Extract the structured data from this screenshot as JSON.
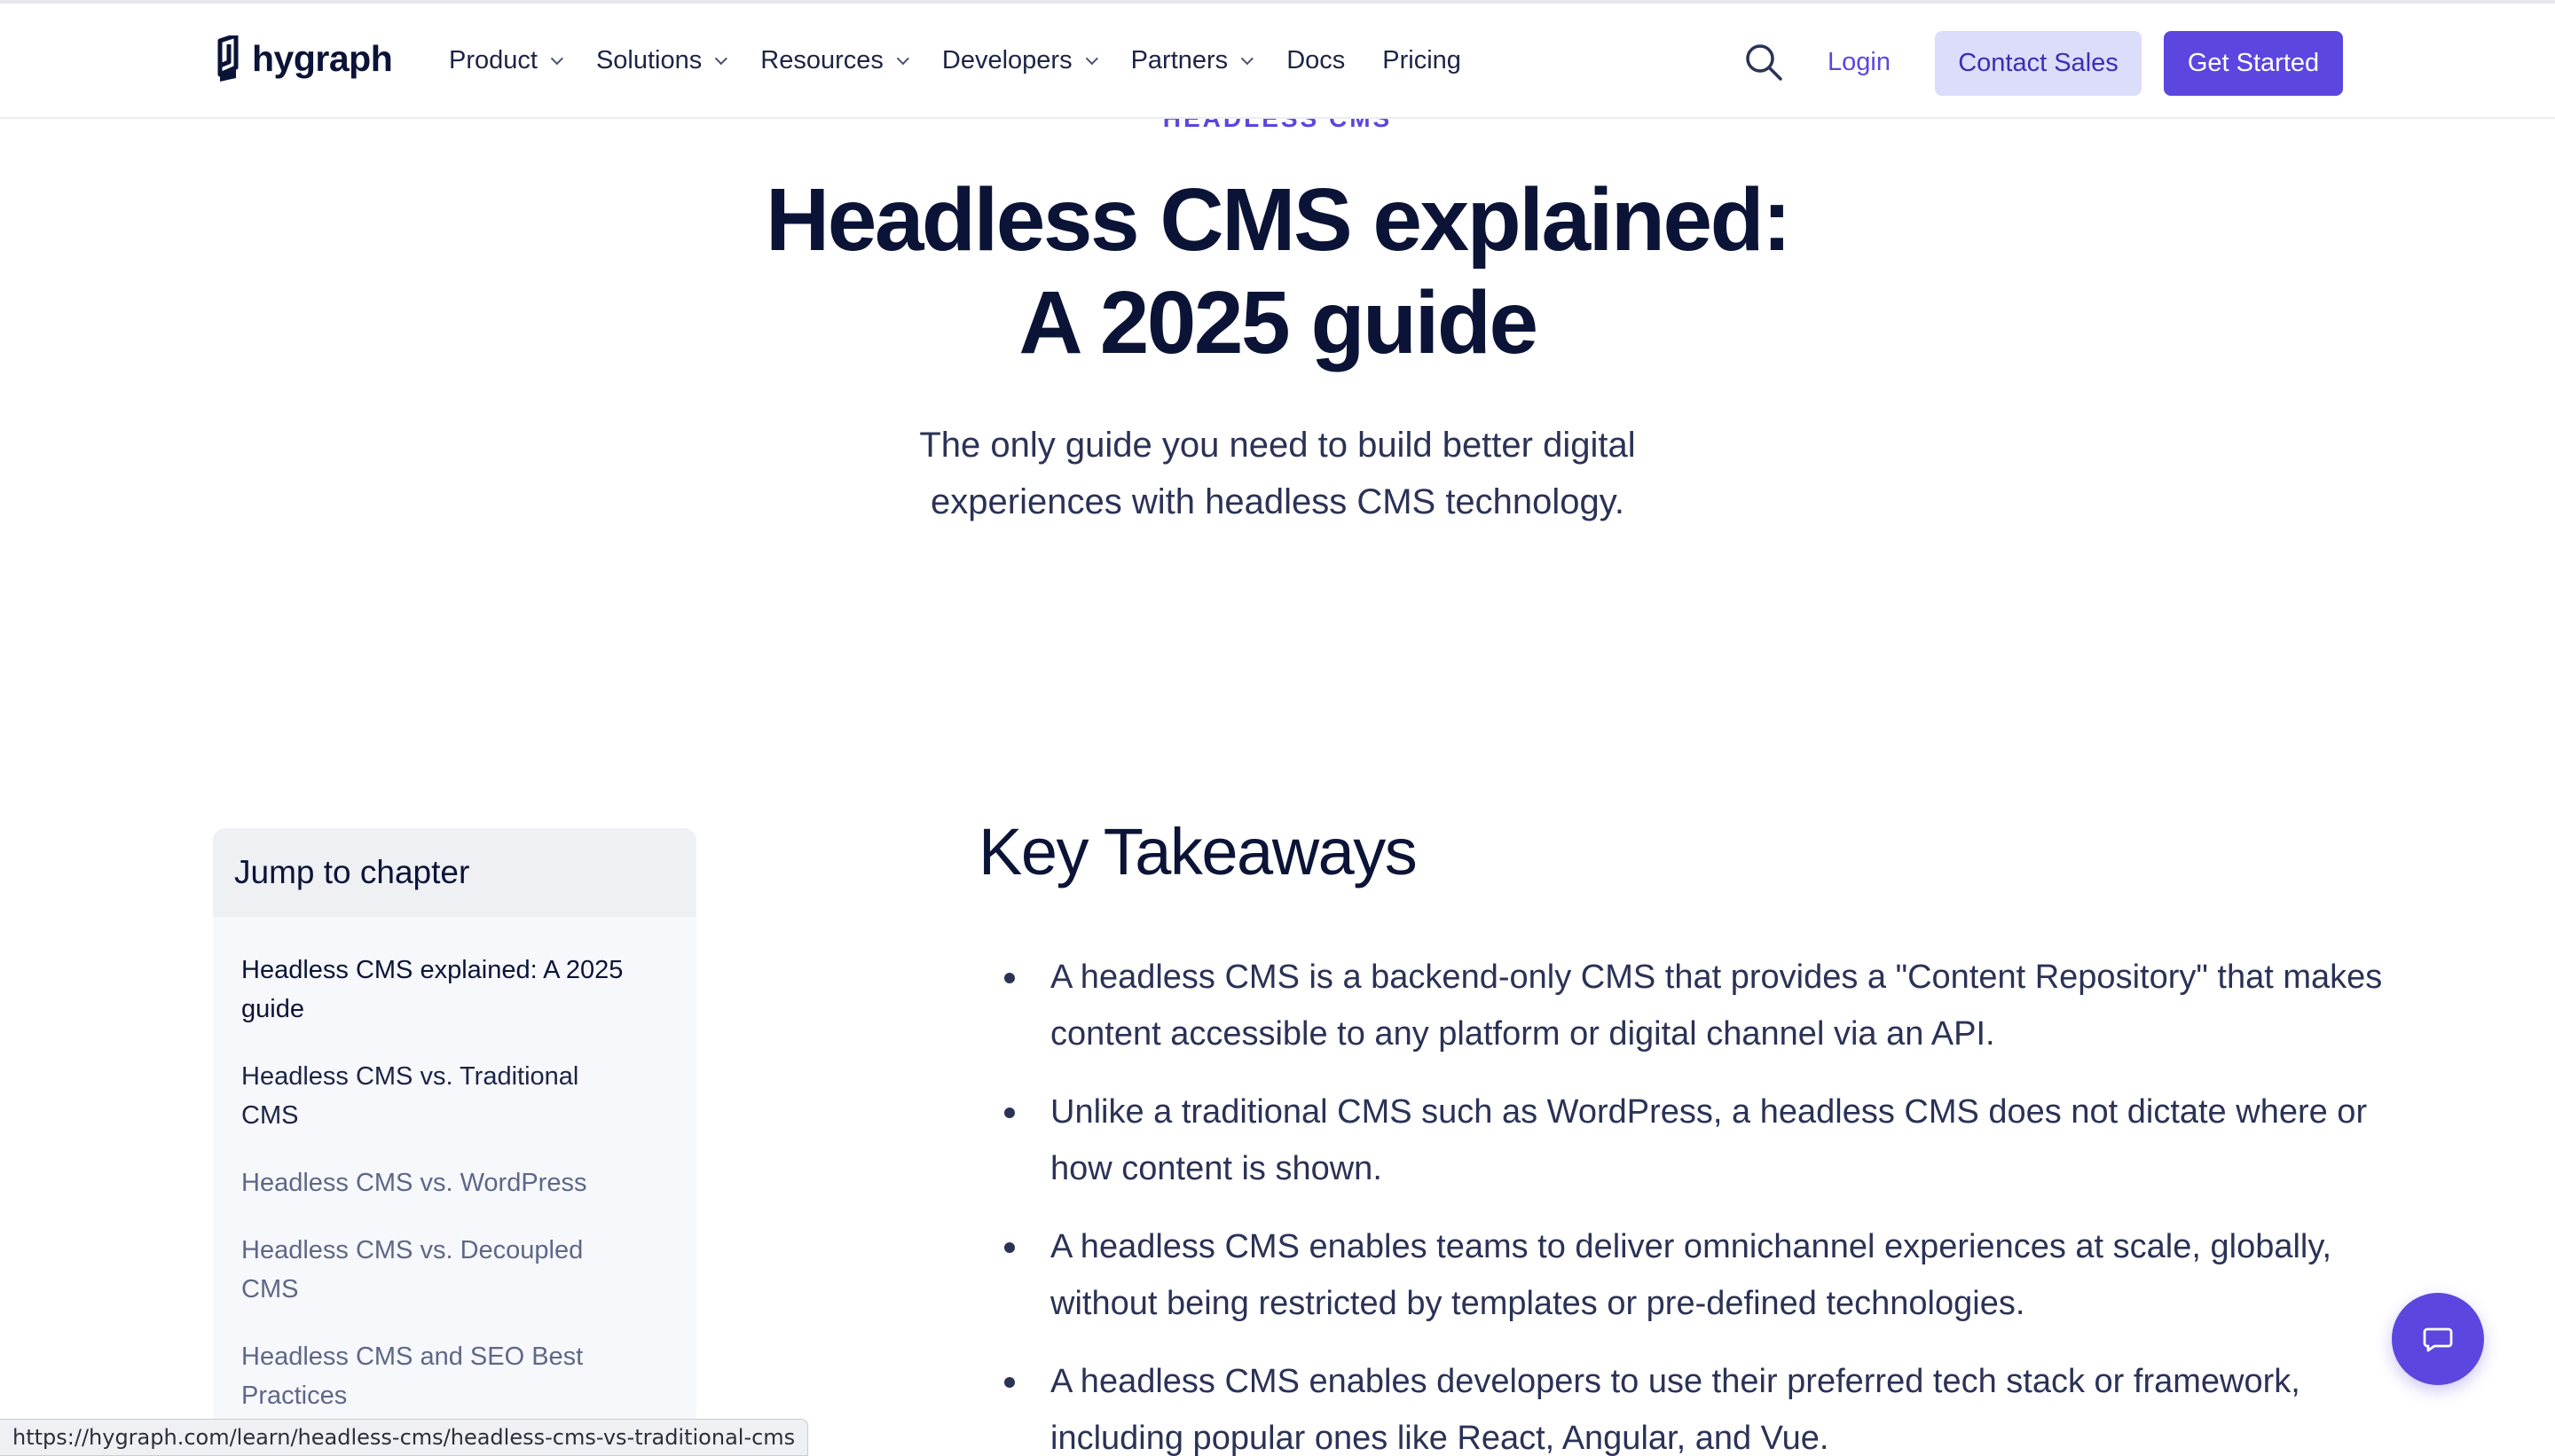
{
  "header": {
    "logo_text": "hygraph",
    "nav": [
      {
        "label": "Product",
        "has_dropdown": true
      },
      {
        "label": "Solutions",
        "has_dropdown": true
      },
      {
        "label": "Resources",
        "has_dropdown": true
      },
      {
        "label": "Developers",
        "has_dropdown": true
      },
      {
        "label": "Partners",
        "has_dropdown": true
      },
      {
        "label": "Docs",
        "has_dropdown": false
      },
      {
        "label": "Pricing",
        "has_dropdown": false
      }
    ],
    "search_icon": "search-icon",
    "login_label": "Login",
    "contact_sales_label": "Contact Sales",
    "get_started_label": "Get Started"
  },
  "hero": {
    "eyebrow": "HEADLESS CMS",
    "title": "Headless CMS explained: A 2025 guide",
    "subtitle": "The only guide you need to build better digital experiences with headless CMS technology."
  },
  "toc": {
    "heading": "Jump to chapter",
    "items": [
      "Headless CMS explained: A 2025 guide",
      "Headless CMS vs. Traditional CMS",
      "Headless CMS vs. WordPress",
      "Headless CMS vs. Decoupled CMS",
      "Headless CMS and SEO Best Practices"
    ]
  },
  "key_takeaways": {
    "title": "Key Takeaways",
    "items": [
      "A headless CMS is a backend-only CMS that provides a \"Content Repository\" that makes content accessible to any platform or digital channel via an API.",
      "Unlike a traditional CMS such as WordPress, a headless CMS does not dictate where or how content is shown.",
      "A headless CMS enables teams to deliver omnichannel experiences at scale, globally, without being restricted by templates or pre-defined technologies.",
      "A headless CMS enables developers to use their preferred tech stack or framework, including popular ones like React, Angular, and Vue."
    ]
  },
  "chat": {
    "icon": "chat-bubble-icon"
  },
  "status_bar": {
    "url": "https://hygraph.com/learn/headless-cms/headless-cms-vs-traditional-cms"
  },
  "colors": {
    "accent": "#5b46df",
    "accent_soft": "#dcdcfb",
    "text_dark": "#0b1437",
    "text_muted": "#5e6788"
  }
}
